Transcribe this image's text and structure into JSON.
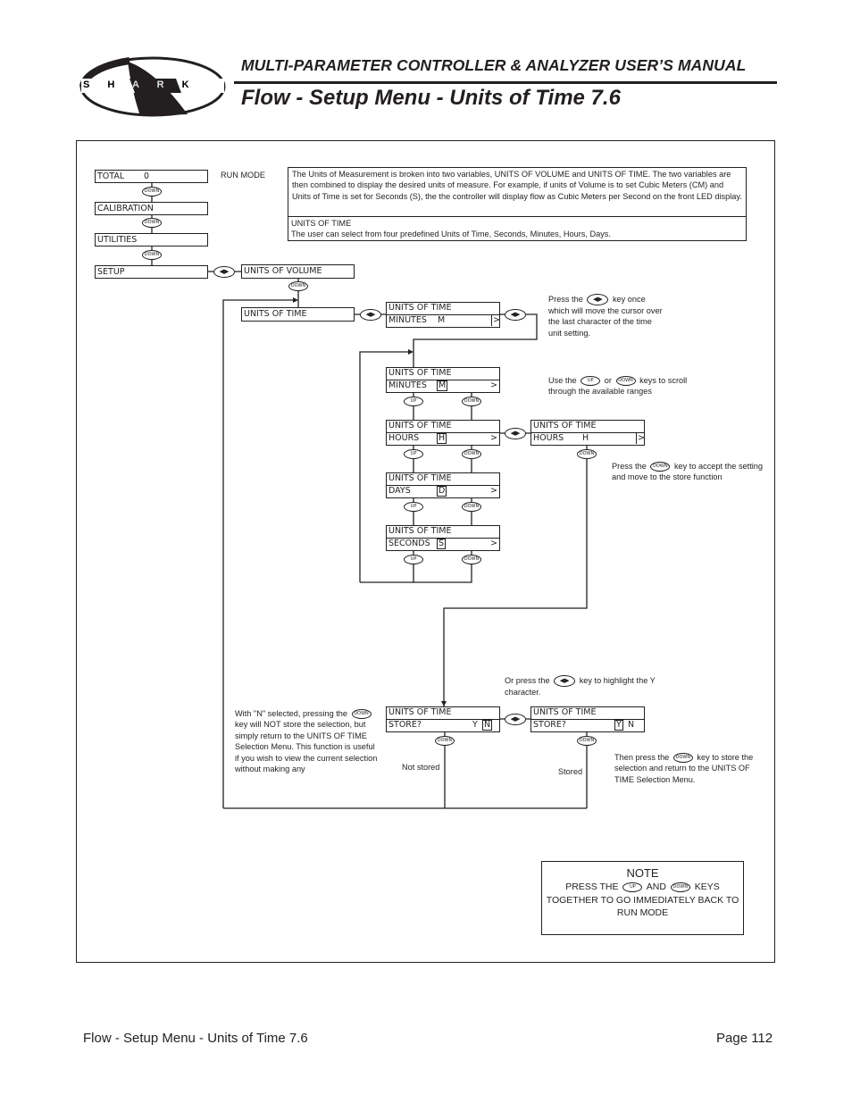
{
  "header": {
    "logo_text": "S H A R K",
    "manual_title": "MULTI-PARAMETER CONTROLLER & ANALYZER USER’S MANUAL",
    "page_title": "Flow - Setup Menu - Units of Time 7.6"
  },
  "icons": {
    "down_key": "DOWN",
    "up_key": "UP",
    "left_right_key": "◀▶"
  },
  "menu": {
    "total": {
      "label": "TOTAL",
      "value": "0"
    },
    "run_mode": "RUN MODE",
    "calibration": "CALIBRATION",
    "utilities": "UTILITIES",
    "setup": "SETUP",
    "units_of_volume": "UNITS OF VOLUME",
    "units_of_time": "UNITS OF TIME"
  },
  "description": {
    "paragraph": "The Units of Measurement is broken into two variables, UNITS OF VOLUME and UNITS OF TIME. The two variables are then combined to display the desired units of measure. For example, if units of Volume is to set Cubic Meters (CM) and Units of Time is set for Seconds (S), the the controller will display flow as Cubic Meters per Second on the front LED display.",
    "heading": "UNITS OF TIME",
    "detail": "The user can select from four predefined Units of Time, Seconds, Minutes, Hours, Days."
  },
  "screens": {
    "title": "UNITS OF TIME",
    "minutes_initial": {
      "label": "MINUTES",
      "code": "M",
      "arrow": ">"
    },
    "minutes": {
      "label": "MINUTES",
      "code": "M",
      "arrow": ">"
    },
    "hours": {
      "label": "HOURS",
      "code": "H",
      "arrow": ">"
    },
    "hours_selected": {
      "label": "HOURS",
      "code": "H",
      "arrow": ">"
    },
    "days": {
      "label": "DAYS",
      "code": "D",
      "arrow": ">"
    },
    "seconds": {
      "label": "SECONDS",
      "code": "S",
      "arrow": ">"
    },
    "store_no": {
      "label": "STORE?",
      "yes": "Y",
      "no": "N"
    },
    "store_yes": {
      "label": "STORE?",
      "yes": "Y",
      "no": "N"
    }
  },
  "annotations": {
    "press_lr": {
      "before": "Press the",
      "after": "key once which will move the cursor over the last character of the time unit setting."
    },
    "use_up_down": {
      "before": "Use the",
      "or": "or",
      "after": "keys to scroll through the available ranges"
    },
    "press_down_accept": {
      "before": "Press the",
      "after": "key to accept the setting and move to the store function"
    },
    "or_press_lr": {
      "before": "Or press the",
      "after": "key to highlight the Y character."
    },
    "n_selected": {
      "before": "With \"N\" selected, pressing the",
      "after": "key will NOT store the selection, but simply return to the UNITS OF TIME Selection Menu. This function is useful if you wish to view the current selection without making any"
    },
    "then_press_down": {
      "before": "Then press the",
      "after": "key to store the selection and return to the UNITS OF TIME Selection Menu."
    },
    "not_stored": "Not stored",
    "stored": "Stored"
  },
  "note": {
    "title": "NOTE",
    "line1_before": "PRESS THE",
    "line1_and": "AND",
    "line1_after": "KEYS",
    "line2": "TOGETHER TO GO IMMEDIATELY BACK TO RUN MODE"
  },
  "footer": {
    "section": "Flow - Setup Menu - Units of Time 7.6",
    "page": "Page 112"
  }
}
